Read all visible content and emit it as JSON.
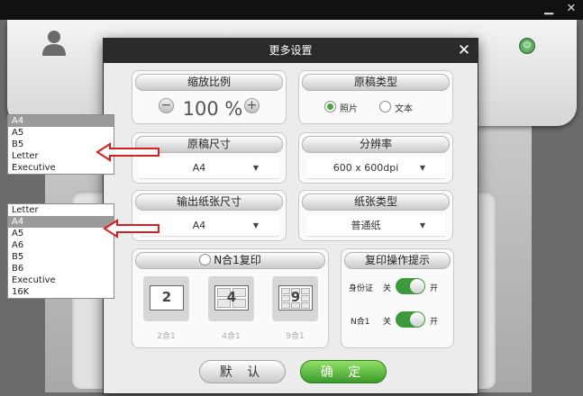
{
  "dialog": {
    "title": "更多设置",
    "close_glyph": "✕",
    "zoom": {
      "header": "缩放比例",
      "minus": "−",
      "plus": "+",
      "value": "100 %"
    },
    "source_type": {
      "header": "原稿类型",
      "options": [
        "照片",
        "文本"
      ],
      "selected": "照片"
    },
    "source_size": {
      "header": "原稿尺寸",
      "value": "A4"
    },
    "resolution": {
      "header": "分辨率",
      "value": "600 x 600dpi"
    },
    "output_size": {
      "header": "输出纸张尺寸",
      "value": "A4"
    },
    "paper_type": {
      "header": "纸张类型",
      "value": "普通纸"
    },
    "nup": {
      "header": "N合1复印",
      "options": [
        {
          "num": "2",
          "label": "2合1"
        },
        {
          "num": "4",
          "label": "4合1"
        },
        {
          "num": "9",
          "label": "9合1"
        }
      ]
    },
    "copy_tips": {
      "header": "复印操作提示",
      "rows": [
        {
          "label": "身份证",
          "off": "关",
          "on": "开",
          "state": "on"
        },
        {
          "label": "N合1",
          "off": "关",
          "on": "开",
          "state": "on"
        }
      ]
    },
    "buttons": {
      "cancel": "默 认",
      "ok": "确 定"
    }
  },
  "dropdown_source_size": {
    "items": [
      "A4",
      "A5",
      "B5",
      "Letter",
      "Executive"
    ],
    "selected": "A4"
  },
  "dropdown_output_size": {
    "items": [
      "Letter",
      "A4",
      "A5",
      "A6",
      "B5",
      "B6",
      "Executive",
      "16K"
    ],
    "selected": "A4"
  },
  "icons": {
    "power": "power-icon",
    "user": "user-icon",
    "arrow": "red-arrow-icon"
  },
  "colors": {
    "accent_green": "#4aa53b",
    "title_bar": "#2b2b2b",
    "annotation_red": "#d62020"
  }
}
